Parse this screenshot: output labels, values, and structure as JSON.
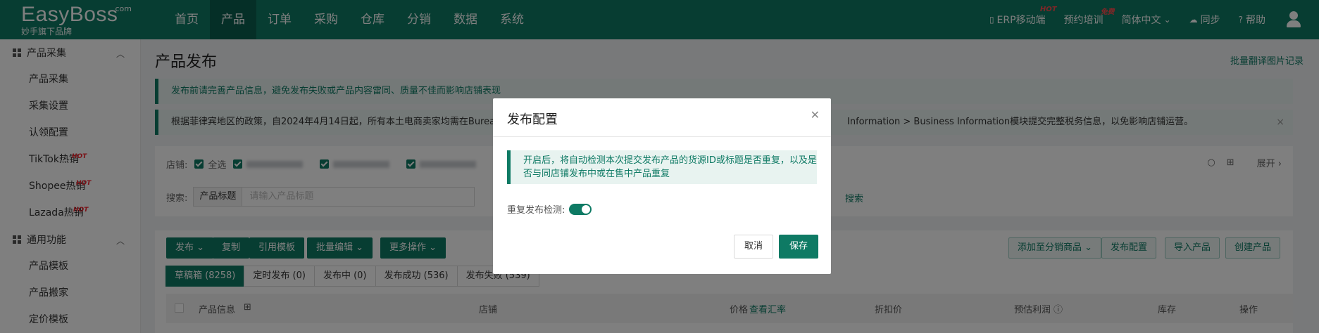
{
  "logo": {
    "brand": "EasyBoss",
    "com": ".com",
    "slogan": "妙手旗下品牌"
  },
  "nav": [
    "首页",
    "产品",
    "订单",
    "采购",
    "仓库",
    "分销",
    "数据",
    "系统"
  ],
  "active_nav": "产品",
  "topright": {
    "erp": "ERP移动端",
    "erp_badge": "HOT",
    "training": "预约培训",
    "training_badge": "免费",
    "lang": "简体中文",
    "sync": "同步",
    "help": "帮助"
  },
  "sidebar": {
    "group1": "产品采集",
    "group1_items": [
      "产品采集",
      "采集设置",
      "认领配置",
      "TikTok热销",
      "Shopee热销",
      "Lazada热销"
    ],
    "hot_badge": "HOT",
    "group2": "通用功能",
    "group2_items": [
      "产品模板",
      "产品搬家",
      "定价模板"
    ]
  },
  "page": {
    "title": "产品发布",
    "top_link": "批量翻译图片记录",
    "notice1": "发布前请完善产品信息，避免发布失败或产品内容雷同、质量不佳而影响店铺表现",
    "notice2_left": "根据菲律宾地区的政策，自2024年4月14日起，所有本土电商卖家均需在Bureau",
    "notice2_right": "Information > Business Information模块提交完整税务信息，以免影响店铺运营。",
    "notice2_close": "×"
  },
  "filter": {
    "shop_label": "店铺:",
    "select_all": "全选",
    "search_label": "搜索:",
    "search_field": "产品标题",
    "search_placeholder": "请输入产品标题",
    "search_link": "搜索",
    "expand": "展开"
  },
  "toolbar": {
    "publish": "发布",
    "copy": "复制",
    "template": "引用模板",
    "batch_edit": "批量编辑",
    "more": "更多操作",
    "add_distribution": "添加至分销商品",
    "publish_config": "发布配置",
    "import": "导入产品",
    "create": "创建产品"
  },
  "tabs": [
    "草稿箱 (8258)",
    "定时发布 (0)",
    "发布中 (0)",
    "发布成功 (536)",
    "发布失败 (539)"
  ],
  "table_headers": {
    "product": "产品信息",
    "shop": "店铺",
    "price": "价格",
    "rate": "查看汇率",
    "discount": "折扣价",
    "profit": "预估利润",
    "stock": "库存",
    "action": "操作"
  },
  "modal": {
    "title": "发布配置",
    "tip": "开启后，将自动检测本次提交发布产品的货源ID或标题是否重复，以及是否与同店铺发布中或在售中产品重复",
    "toggle_label": "重复发布检测:",
    "cancel": "取消",
    "save": "保存"
  },
  "colors": {
    "brand": "#0e7a64",
    "hot": "#ff4d4f"
  }
}
